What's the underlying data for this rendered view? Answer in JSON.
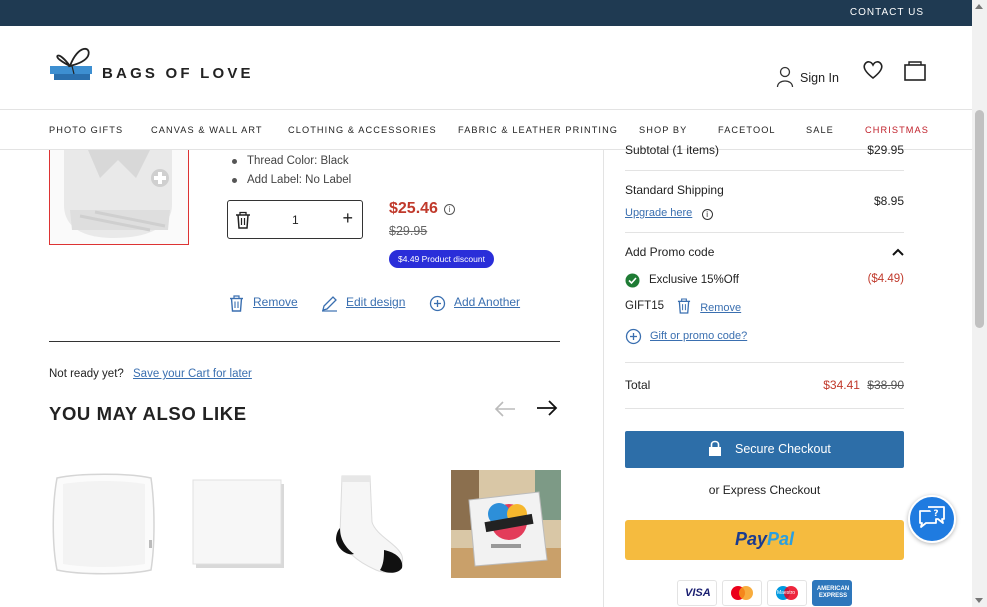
{
  "topbar": {
    "contact_label": "CONTACT US"
  },
  "header": {
    "brand_name": "BAGS OF LOVE",
    "sign_in_label": "Sign In"
  },
  "nav": {
    "items": [
      "PHOTO GIFTS",
      "CANVAS & WALL ART",
      "CLOTHING & ACCESSORIES",
      "FABRIC & LEATHER PRINTING",
      "SHOP BY",
      "FACETOOL",
      "SALE",
      "CHRISTMAS"
    ]
  },
  "cart_item": {
    "options": [
      "Thread Color: Black",
      "Add Label: No Label"
    ],
    "quantity": "1",
    "price_now": "$25.46",
    "price_old": "$29.95",
    "discount_badge": "$4.49 Product discount",
    "actions": {
      "remove": "Remove",
      "edit_design": "Edit design",
      "add_another": "Add Another"
    }
  },
  "save_cart": {
    "prompt": "Not ready yet?",
    "link": "Save your Cart for later"
  },
  "recommendations": {
    "heading": "YOU MAY ALSO LIKE",
    "product_icons": [
      "cushion-insert",
      "blank-tile",
      "sock",
      "contrado-pack"
    ]
  },
  "summary": {
    "subtotal_label": "Subtotal (1 items)",
    "subtotal_value": "$29.95",
    "shipping_label": "Standard Shipping",
    "shipping_value": "$8.95",
    "upgrade_link": "Upgrade here",
    "promo_heading": "Add Promo code",
    "promo_applied_label": "Exclusive 15%Off",
    "promo_applied_value": "($4.49)",
    "promo_code": "GIFT15",
    "promo_remove": "Remove",
    "gift_link": "Gift or promo code?",
    "total_label": "Total",
    "total_now": "$34.41",
    "total_old": "$38.90",
    "checkout_label": "Secure Checkout",
    "express_label": "or Express Checkout",
    "paypal_a": "Pay",
    "paypal_b": "Pal",
    "card_visa": "VISA",
    "card_maestro": "Maestro",
    "card_amex": "AMERICAN EXPRESS"
  },
  "colors": {
    "topbar": "#1f3a52",
    "accent_red": "#c0392b",
    "link_blue": "#3a6fb0",
    "checkout_blue": "#2d6ea8",
    "paypal_yellow": "#f5bb3f",
    "badge_blue": "#2a2ed9",
    "chat_blue": "#1f7be0"
  }
}
